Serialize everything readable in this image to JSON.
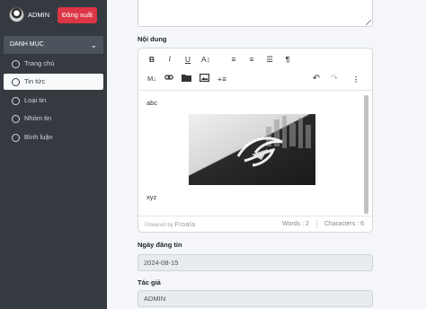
{
  "sidebar": {
    "user_name": "ADMIN",
    "logout_label": "Đăng xuất",
    "menu_header": "DANH MỤC",
    "items": [
      {
        "label": "Trang chủ",
        "active": false
      },
      {
        "label": "Tin tức",
        "active": true
      },
      {
        "label": "Loại tin",
        "active": false
      },
      {
        "label": "Nhóm tin",
        "active": false
      },
      {
        "label": "Bình luận",
        "active": false
      }
    ]
  },
  "form": {
    "content_label": "Nội dung",
    "editor": {
      "toolbar_row1": [
        "B",
        "i",
        "U",
        "A↕",
        "≡",
        "≡",
        "☰",
        "¶"
      ],
      "toolbar_row2": [
        "M↓",
        "🔗",
        "▬",
        "▣",
        "+≡",
        "↶",
        "↷",
        "⋮"
      ],
      "text_before": "abc",
      "text_after": "xyz",
      "powered_by": "Powered by",
      "brand": "Froala",
      "words": "Words : 2",
      "characters": "Characters : 6"
    },
    "date_label": "Ngày đăng tin",
    "date_value": "2024-08-15",
    "author_label": "Tác giả",
    "author_value": "ADMIN"
  }
}
